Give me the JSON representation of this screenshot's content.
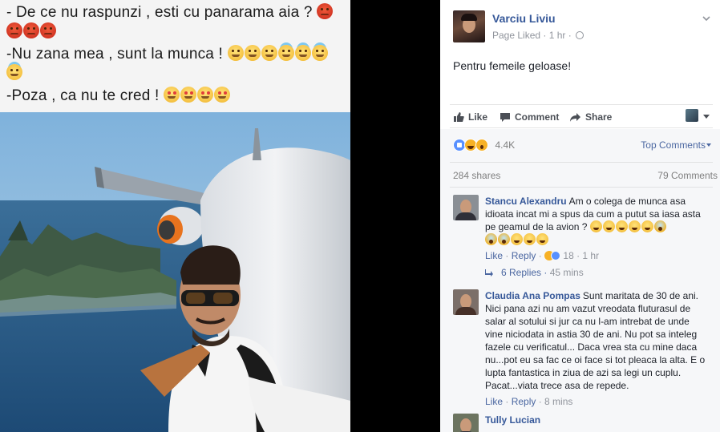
{
  "caption": {
    "line1": "- De ce nu raspunzi ,  esti cu panarama aia ?",
    "line2": "-Nu zana mea , sunt la munca !",
    "line3": "-Poza , ca nu te cred !"
  },
  "post": {
    "page_name": "Varciu Liviu",
    "meta": "Page Liked · 1 hr ·",
    "text": "Pentru femeile geloase!",
    "actions": {
      "like": "Like",
      "comment": "Comment",
      "share": "Share"
    }
  },
  "reactions": {
    "count": "4.4K",
    "icons": [
      "like-icon",
      "haha-icon",
      "wow-icon"
    ],
    "sort_label": "Top Comments",
    "shares": "284 shares",
    "comments": "79 Comments"
  },
  "comments": [
    {
      "author": "Stancu Alexandru",
      "text": "Am o colega de munca asa idioata incat mi a spus da cum a putut sa iasa asta pe geamul de la avion ?",
      "like": "Like",
      "reply": "Reply",
      "reaction_count": "18",
      "time": "1 hr",
      "replies": "6 Replies",
      "replies_time": "45 mins"
    },
    {
      "author": "Claudia Ana Pompas",
      "text": "Sunt maritata de 30 de ani. Nici pana azi nu am vazut vreodata fluturasul de salar al sotului si jur ca nu l-am intrebat de unde vine niciodata in astia 30 de ani. Nu pot sa inteleg fazele cu verificatul... Daca vrea sta cu mine daca nu...pot eu sa fac ce oi face si tot pleaca la alta. E o lupta fantastica in ziua de azi sa legi un cuplu. Pacat...viata trece asa de repede.",
      "like": "Like",
      "reply": "Reply",
      "time": "8 mins"
    },
    {
      "author": "Tully Lucian"
    }
  ],
  "colors": {
    "fb_blue": "#365899",
    "link_blue": "#4b67a1",
    "meta_gray": "#90949c"
  }
}
